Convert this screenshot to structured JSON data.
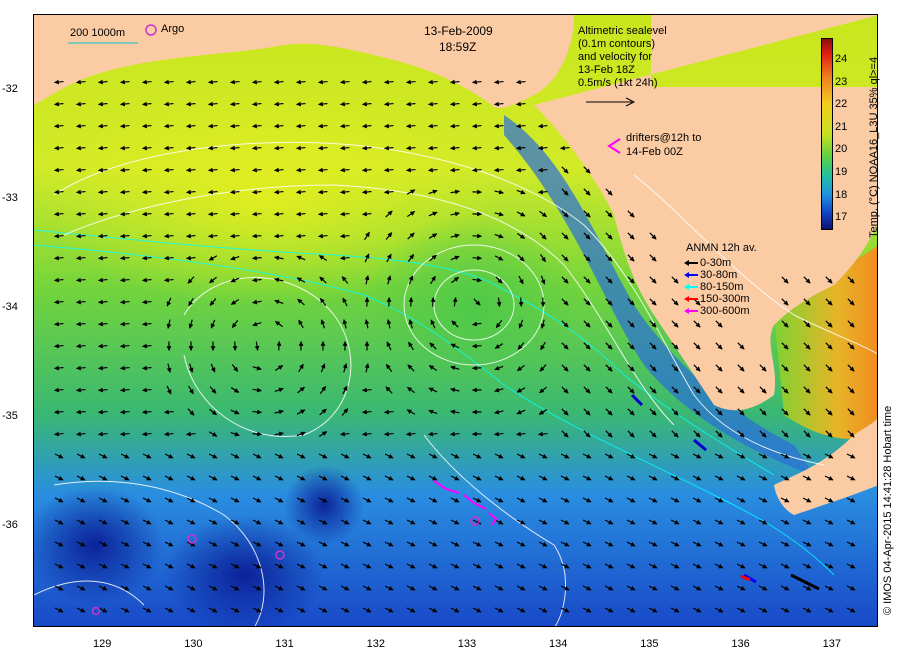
{
  "title": {
    "date": "13-Feb-2009",
    "time": "18:59Z"
  },
  "scale_legend": {
    "label": "200  1000m",
    "argo_label": "Argo"
  },
  "altimetry_note": [
    "Altimetric sealevel",
    "(0.1m contours)",
    "and velocity for",
    "13-Feb 18Z",
    "0.5m/s (1kt 24h)"
  ],
  "drifters_note": [
    "drifters@12h to",
    "14-Feb 00Z"
  ],
  "anmn_legend": {
    "title": "ANMN 12h av.",
    "items": [
      {
        "label": "0-30m",
        "color": "#000000"
      },
      {
        "label": "30-80m",
        "color": "#0000ff"
      },
      {
        "label": "80-150m",
        "color": "#00ffff"
      },
      {
        "label": "150-300m",
        "color": "#ff0000"
      },
      {
        "label": "300-600m",
        "color": "#ff00ff"
      }
    ]
  },
  "colorbar": {
    "title": "Temp. (°C) NOAA16_L3U 35% ql>=4",
    "ticks": [
      "24",
      "23",
      "22",
      "21",
      "20",
      "19",
      "18",
      "17"
    ]
  },
  "y_axis": [
    "-32",
    "-33",
    "-34",
    "-35",
    "-36"
  ],
  "x_axis": [
    "129",
    "130",
    "131",
    "132",
    "133",
    "134",
    "135",
    "136",
    "137"
  ],
  "credit": "© IMOS 04-Apr-2015 14:41:28 Hobart time",
  "colors": {
    "land": "#fbcca4",
    "drifter": "#ff00ff",
    "argo": "#cc33cc",
    "contour": "#ffffff",
    "isobath": "#00ffff"
  }
}
